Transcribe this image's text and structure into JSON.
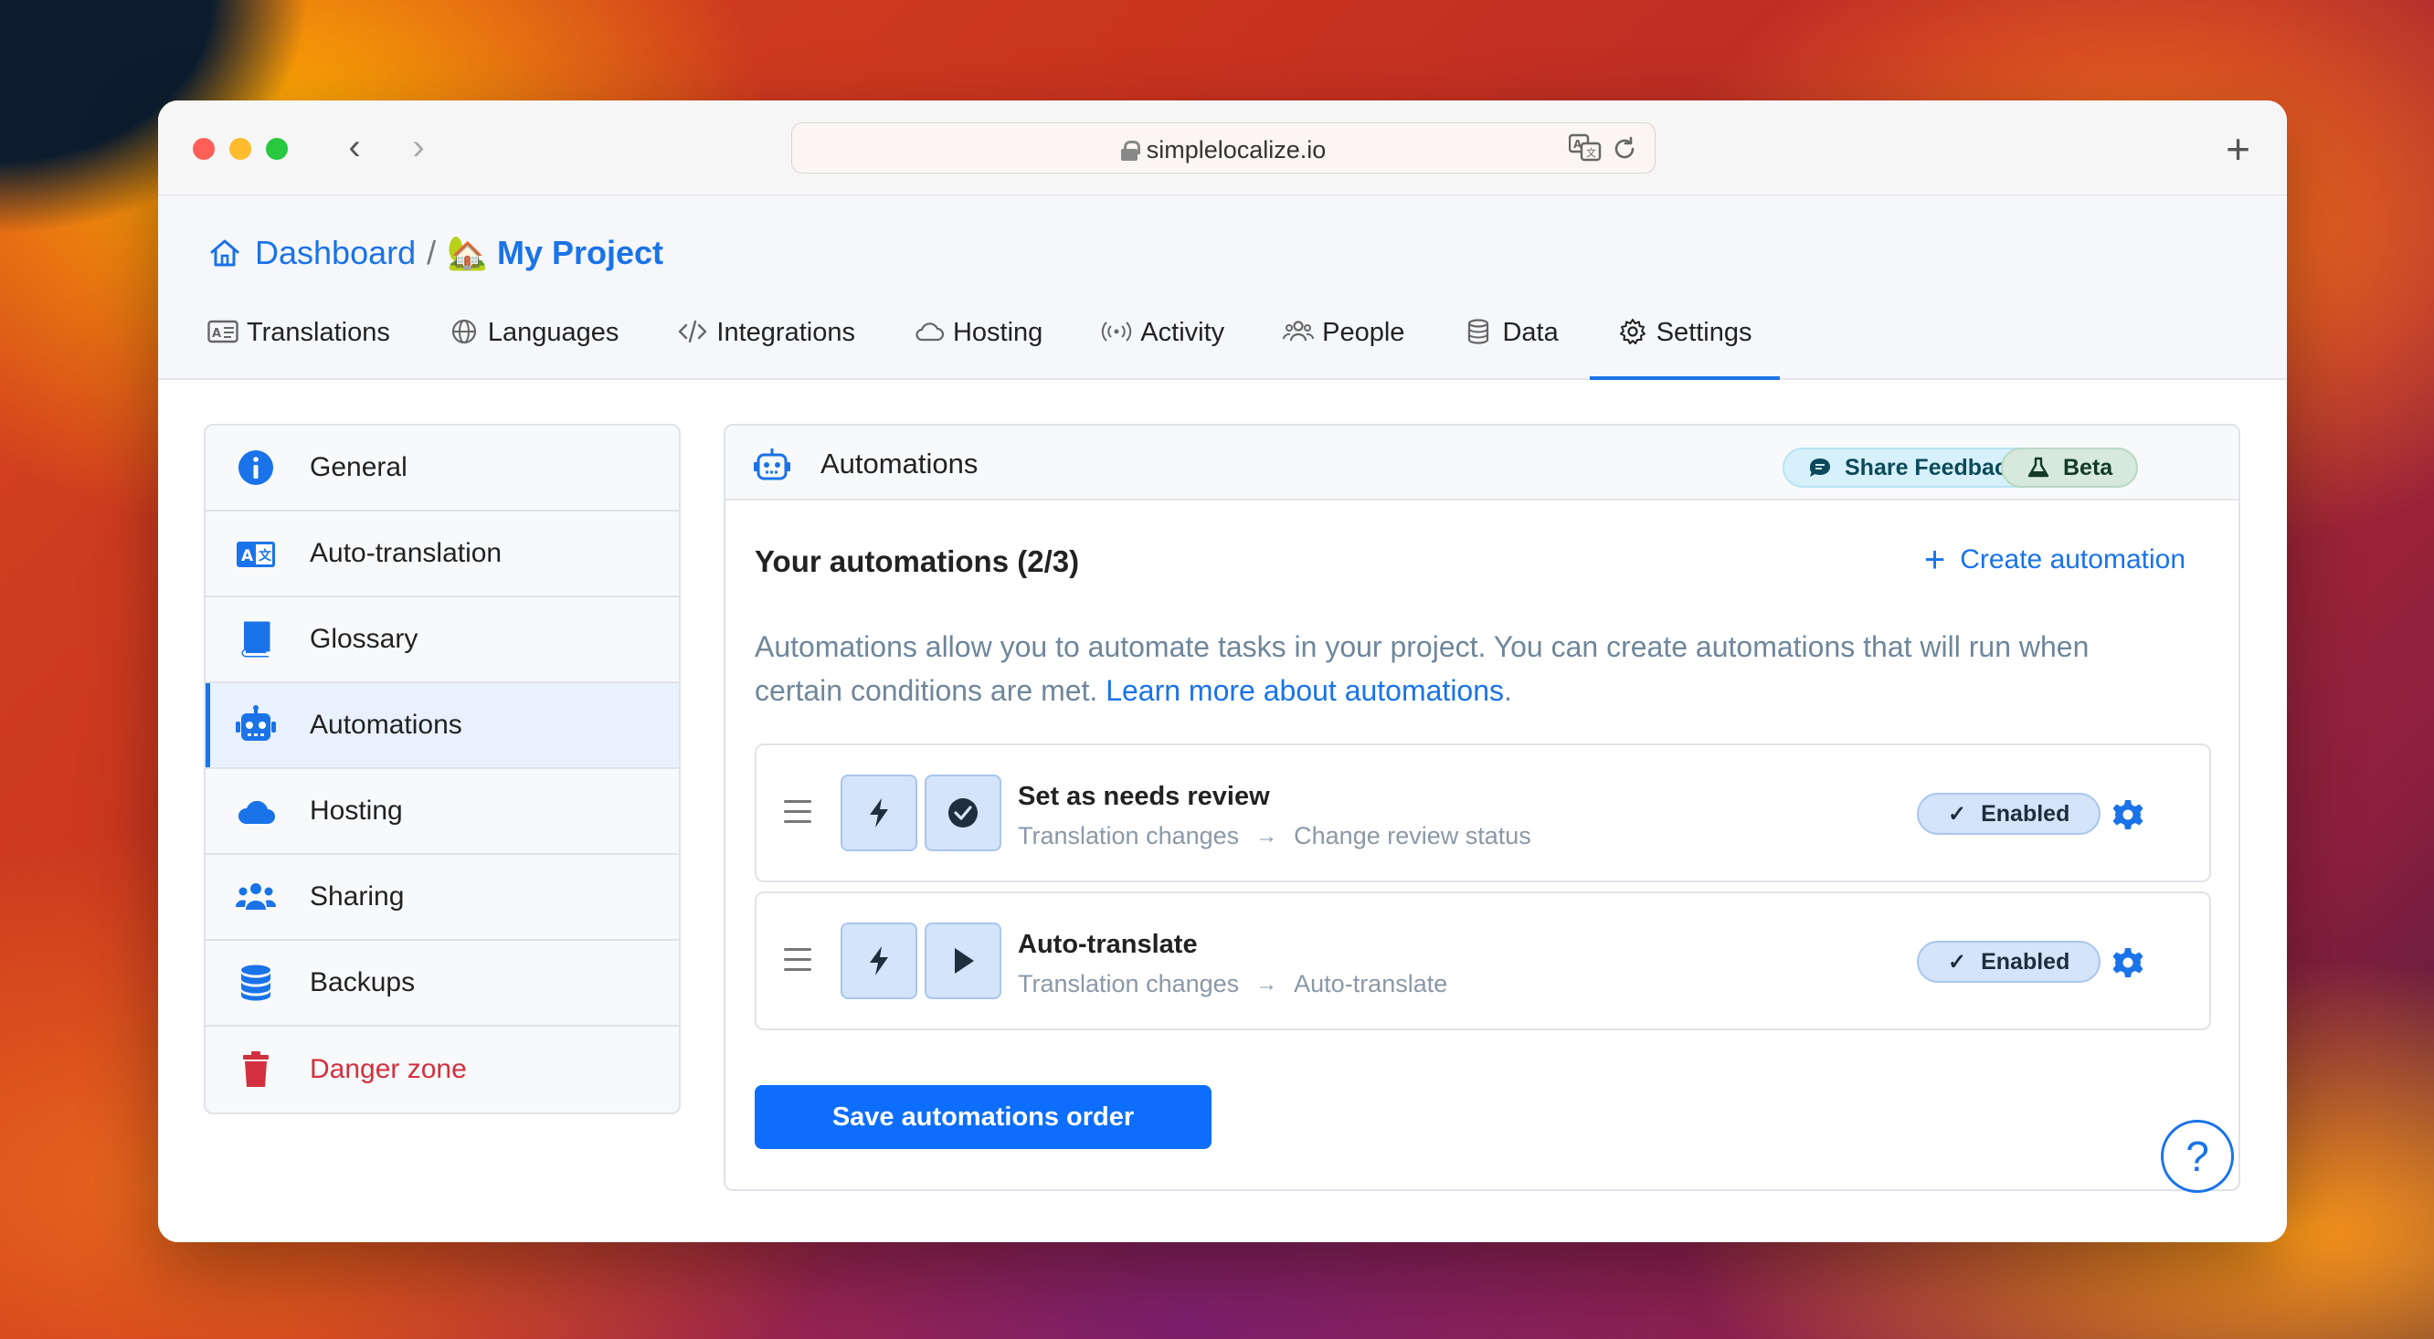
{
  "browser": {
    "url": "simplelocalize.io"
  },
  "breadcrumb": {
    "home": "Dashboard",
    "separator": "/",
    "project_emoji": "🏡",
    "project": "My Project"
  },
  "tabs": [
    {
      "label": "Translations",
      "icon": "translations-icon"
    },
    {
      "label": "Languages",
      "icon": "globe-icon"
    },
    {
      "label": "Integrations",
      "icon": "code-icon"
    },
    {
      "label": "Hosting",
      "icon": "cloud-icon"
    },
    {
      "label": "Activity",
      "icon": "broadcast-icon"
    },
    {
      "label": "People",
      "icon": "people-icon"
    },
    {
      "label": "Data",
      "icon": "database-icon"
    },
    {
      "label": "Settings",
      "icon": "gear-icon",
      "active": true
    }
  ],
  "sidebar": {
    "items": [
      {
        "label": "General",
        "icon": "info-icon"
      },
      {
        "label": "Auto-translation",
        "icon": "translate-icon"
      },
      {
        "label": "Glossary",
        "icon": "book-icon"
      },
      {
        "label": "Automations",
        "icon": "robot-icon",
        "active": true
      },
      {
        "label": "Hosting",
        "icon": "cloud-icon"
      },
      {
        "label": "Sharing",
        "icon": "people-icon"
      },
      {
        "label": "Backups",
        "icon": "database-icon"
      },
      {
        "label": "Danger zone",
        "icon": "trash-icon",
        "danger": true
      }
    ]
  },
  "panel": {
    "title": "Automations",
    "feedback_label": "Share Feedback",
    "beta_label": "Beta",
    "list_title": "Your automations (2/3)",
    "create_label": "Create automation",
    "description": "Automations allow you to automate tasks in your project. You can create automations that will run when certain conditions are met.",
    "learn_more": "Learn more about automations",
    "description_end": ".",
    "automations": [
      {
        "name": "Set as needs review",
        "trigger": "Translation changes",
        "action": "Change review status",
        "status": "Enabled"
      },
      {
        "name": "Auto-translate",
        "trigger": "Translation changes",
        "action": "Auto-translate",
        "status": "Enabled"
      }
    ],
    "save_label": "Save automations order"
  },
  "help": {
    "label": "?"
  },
  "colors": {
    "accent": "#1a73e8",
    "primary_button": "#0d6efd",
    "danger": "#d3303f",
    "enabled_bg": "#d3e4fb"
  }
}
